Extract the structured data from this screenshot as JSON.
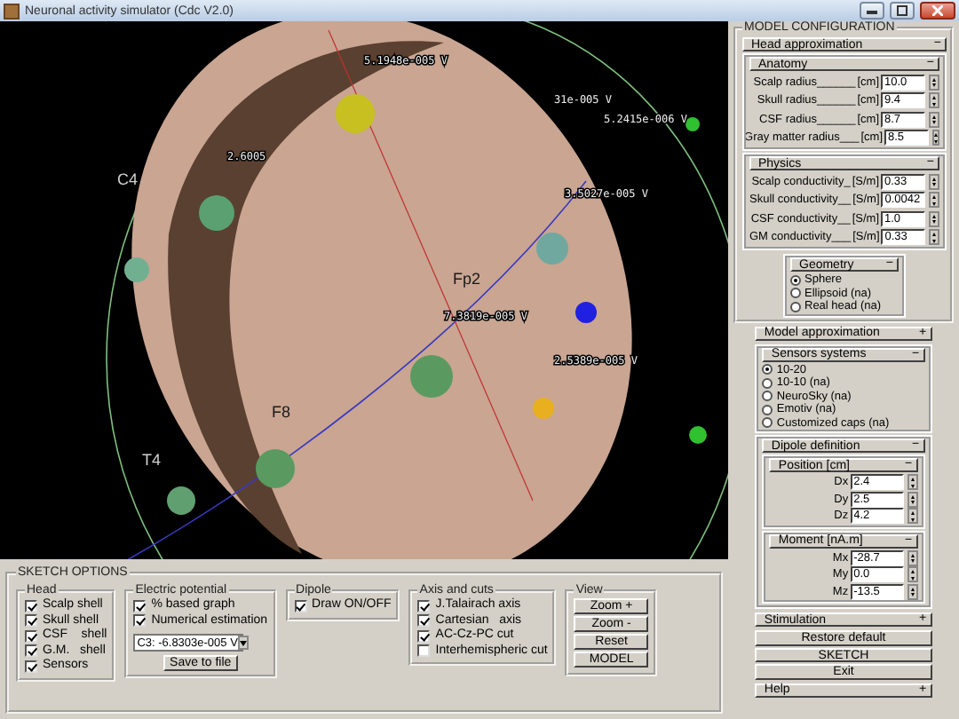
{
  "window": {
    "title": "Neuronal activity simulator (Cdc V2.0)"
  },
  "viewport": {
    "labels": [
      {
        "text": "5.1948e-005 V",
        "kind": "reading"
      },
      {
        "text": "31e-005 V",
        "kind": "reading"
      },
      {
        "text": "5.2415e-006 V",
        "kind": "reading"
      },
      {
        "text": "2.6005",
        "kind": "reading"
      },
      {
        "text": "3.5027e-005 V",
        "kind": "reading"
      },
      {
        "text": "C4",
        "kind": "electrode"
      },
      {
        "text": "Fp2",
        "kind": "electrode"
      },
      {
        "text": "7.3819e-005 V",
        "kind": "reading"
      },
      {
        "text": "2.5389e-005 V",
        "kind": "reading"
      },
      {
        "text": "F8",
        "kind": "electrode"
      },
      {
        "text": "T4",
        "kind": "electrode"
      }
    ]
  },
  "model_configuration": {
    "title": "MODEL CONFIGURATION",
    "head_approximation": {
      "title": "Head approximation",
      "toggle": "−",
      "anatomy": {
        "title": "Anatomy",
        "toggle": "−",
        "fields": [
          {
            "label": "Scalp radius______",
            "unit": "[cm]",
            "value": "10.0"
          },
          {
            "label": "Skull radius______",
            "unit": "[cm]",
            "value": "9.4"
          },
          {
            "label": "CSF radius______",
            "unit": "[cm]",
            "value": "8.7"
          },
          {
            "label": "Gray matter radius___",
            "unit": "[cm]",
            "value": "8.5"
          }
        ]
      },
      "physics": {
        "title": "Physics",
        "toggle": "−",
        "fields": [
          {
            "label": "Scalp conductivity_",
            "unit": "[S/m]",
            "value": "0.33"
          },
          {
            "label": "Skull conductivity__",
            "unit": "[S/m]",
            "value": "0.0042"
          },
          {
            "label": "CSF conductivity__",
            "unit": "[S/m]",
            "value": "1.0"
          },
          {
            "label": "GM conductivity___",
            "unit": "[S/m]",
            "value": "0.33"
          }
        ]
      },
      "geometry": {
        "title": "Geometry",
        "toggle": "−",
        "options": [
          {
            "label": "Sphere",
            "selected": true
          },
          {
            "label": "Ellipsoid (na)",
            "selected": false
          },
          {
            "label": "Real head (na)",
            "selected": false
          }
        ]
      }
    },
    "model_approximation": {
      "title": "Model approximation",
      "toggle": "+"
    },
    "sensors_systems": {
      "title": "Sensors systems",
      "toggle": "−",
      "options": [
        {
          "label": "10-20",
          "selected": true
        },
        {
          "label": "10-10 (na)",
          "selected": false
        },
        {
          "label": "NeuroSky (na)",
          "selected": false
        },
        {
          "label": "Emotiv (na)",
          "selected": false
        },
        {
          "label": "Customized caps (na)",
          "selected": false
        }
      ]
    },
    "dipole_definition": {
      "title": "Dipole definition",
      "toggle": "−",
      "position": {
        "title": "Position [cm]",
        "toggle": "−",
        "fields": [
          {
            "label": "Dx",
            "value": "2.4"
          },
          {
            "label": "Dy",
            "value": "2.5"
          },
          {
            "label": "Dz",
            "value": "4.2"
          }
        ]
      },
      "moment": {
        "title": "Moment [nA.m]",
        "toggle": "−",
        "fields": [
          {
            "label": "Mx",
            "value": "-28.7"
          },
          {
            "label": "My",
            "value": "0.0"
          },
          {
            "label": "Mz",
            "value": "-13.5"
          }
        ]
      }
    },
    "stimulation": {
      "title": "Stimulation",
      "toggle": "+"
    },
    "buttons": [
      "Restore default",
      "SKETCH",
      "Exit"
    ],
    "help": {
      "title": "Help",
      "toggle": "+"
    }
  },
  "sketch_options": {
    "title": "SKETCH OPTIONS",
    "head": {
      "title": "Head",
      "items": [
        {
          "label": "Scalp shell",
          "checked": true
        },
        {
          "label": "Skull shell",
          "checked": true
        },
        {
          "label": "CSF    shell",
          "checked": true
        },
        {
          "label": "G.M.   shell",
          "checked": true
        },
        {
          "label": "Sensors",
          "checked": true
        }
      ]
    },
    "electric_potential": {
      "title": "Electric potential",
      "items": [
        {
          "label": "% based graph",
          "checked": true
        },
        {
          "label": "Numerical estimation",
          "checked": true
        }
      ],
      "dropdown": "C3: -6.8303e-005 V",
      "button": "Save to file"
    },
    "dipole": {
      "title": "Dipole",
      "items": [
        {
          "label": "Draw ON/OFF",
          "checked": true
        }
      ]
    },
    "axis_and_cuts": {
      "title": "Axis and cuts",
      "items": [
        {
          "label": "J.Talairach axis",
          "checked": true
        },
        {
          "label": "Cartesian   axis",
          "checked": true
        },
        {
          "label": "AC-Cz-PC cut",
          "checked": true
        },
        {
          "label": "Interhemispheric cut",
          "checked": false
        }
      ]
    },
    "view": {
      "title": "View",
      "buttons": [
        "Zoom +",
        "Zoom -",
        "Reset",
        "MODEL"
      ]
    }
  }
}
